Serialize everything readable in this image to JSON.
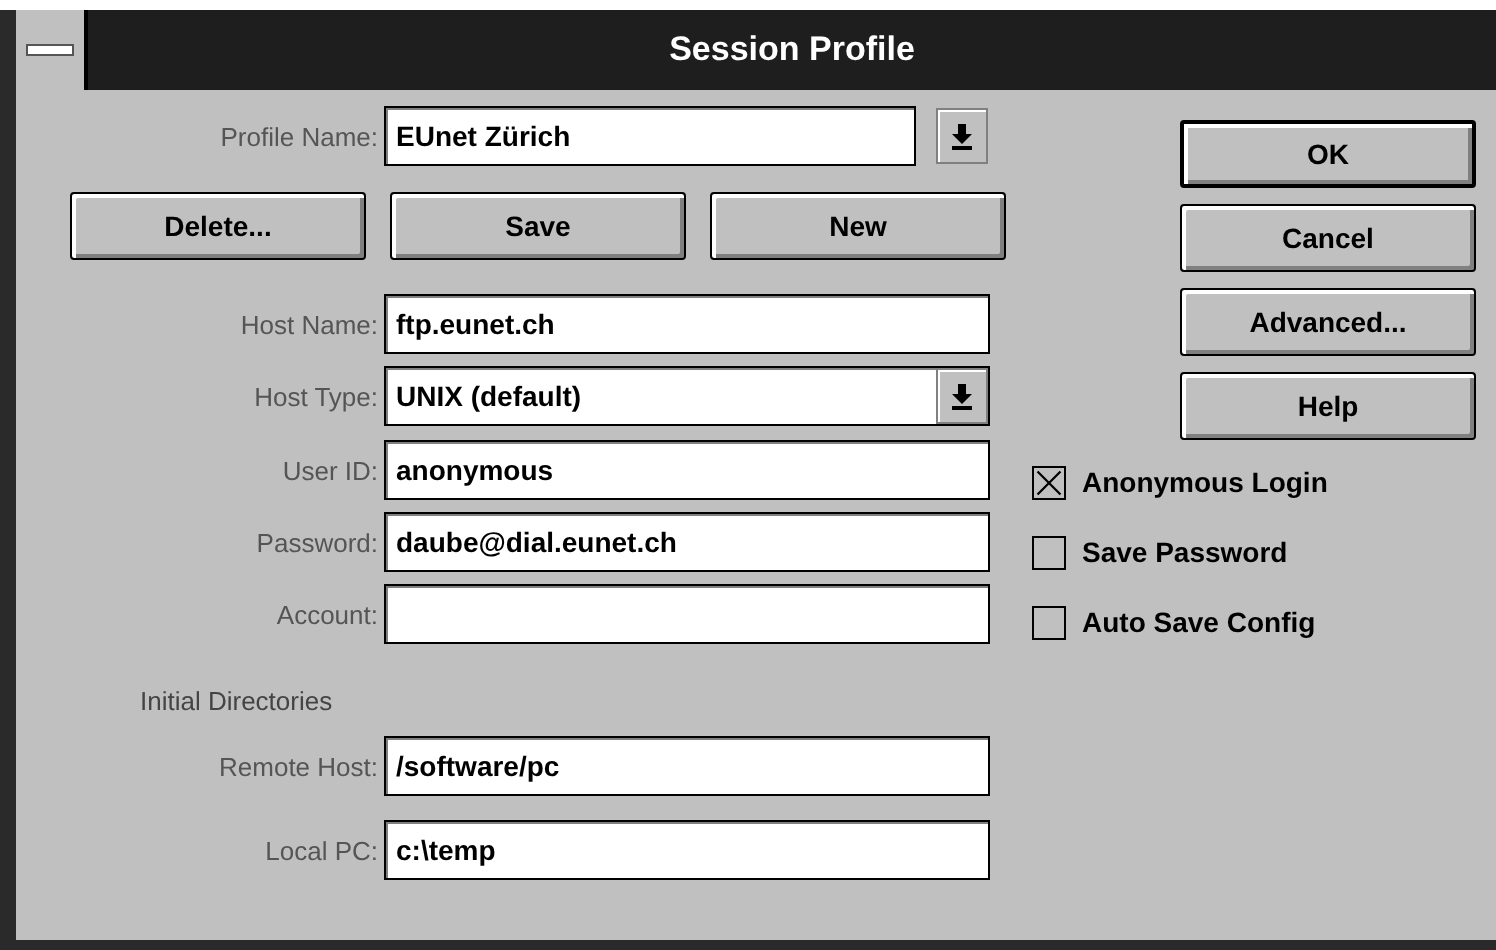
{
  "window": {
    "title": "Session Profile"
  },
  "profile_name": {
    "label": "Profile Name:",
    "value": "EUnet Zürich"
  },
  "profile_buttons": [
    {
      "label": "Delete..."
    },
    {
      "label": "Save"
    },
    {
      "label": "New"
    }
  ],
  "fields": [
    {
      "label": "Host Name:",
      "value": "ftp.eunet.ch",
      "kind": "text"
    },
    {
      "label": "Host Type:",
      "value": "UNIX (default)",
      "kind": "combo"
    },
    {
      "label": "User ID:",
      "value": "anonymous",
      "kind": "text"
    },
    {
      "label": "Password:",
      "value": "daube@dial.eunet.ch",
      "kind": "text"
    },
    {
      "label": "Account:",
      "kind": "text"
    }
  ],
  "section_label": "Initial Directories",
  "directories": [
    {
      "label": "Remote Host:",
      "value": "/software/pc"
    },
    {
      "label": "Local PC:",
      "value": "c:\\temp"
    }
  ],
  "dialog_buttons": [
    {
      "label": "OK",
      "default": true
    },
    {
      "label": "Cancel",
      "default": false
    },
    {
      "label": "Advanced...",
      "default": false
    },
    {
      "label": "Help",
      "default": false
    }
  ],
  "options": [
    {
      "label": "Anonymous Login",
      "checked": true
    },
    {
      "label": "Save Password",
      "checked": false
    },
    {
      "label": "Auto Save Config",
      "checked": false
    }
  ]
}
